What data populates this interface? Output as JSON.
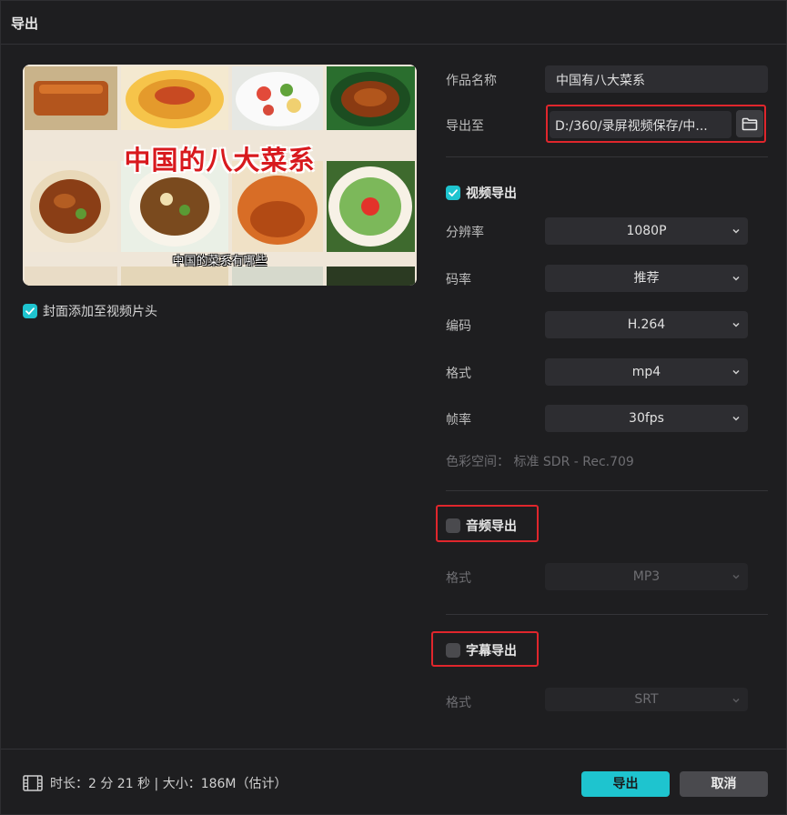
{
  "window": {
    "title": "导出"
  },
  "cover": {
    "title_text": "中国的八大菜系",
    "subtitle_text": "中国的菜系有哪些",
    "add_cover_label": "封面添加至视频片头",
    "add_cover_checked": true
  },
  "form": {
    "name_label": "作品名称",
    "name_value": "中国有八大菜系",
    "export_to_label": "导出至",
    "export_path": "D:/360/录屏视频保存/中..."
  },
  "video_export": {
    "label": "视频导出",
    "checked": true,
    "resolution_label": "分辨率",
    "resolution_value": "1080P",
    "bitrate_label": "码率",
    "bitrate_value": "推荐",
    "codec_label": "编码",
    "codec_value": "H.264",
    "format_label": "格式",
    "format_value": "mp4",
    "framerate_label": "帧率",
    "framerate_value": "30fps",
    "colorspace_text": "色彩空间：  标准 SDR - Rec.709"
  },
  "audio_export": {
    "label": "音频导出",
    "checked": false,
    "format_label": "格式",
    "format_value": "MP3"
  },
  "subtitle_export": {
    "label": "字幕导出",
    "checked": false,
    "format_label": "格式",
    "format_value": "SRT"
  },
  "footer": {
    "info_text": "时长：2 分 21 秒 | 大小：186M（估计）",
    "export_button": "导出",
    "cancel_button": "取消"
  },
  "colors": {
    "accent": "#1ec4cf",
    "highlight_box": "#e0262c",
    "background": "#1e1e20"
  },
  "icons": [
    "folder-icon",
    "chevron-down-icon",
    "check-icon",
    "film-icon"
  ]
}
